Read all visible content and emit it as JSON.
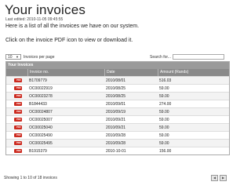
{
  "page": {
    "title": "Your invoices",
    "last_edited_label": "Last edited:",
    "last_edited_value": "2010-11-05 09:45:55",
    "intro": "Here is a list of all the invoices we have on our system.",
    "hint": "Click on the invoice PDF icon to view or download it."
  },
  "controls": {
    "per_page_value": "10",
    "per_page_label": "Invoices per page",
    "search_label": "Search for..."
  },
  "table": {
    "heading": "Your Invoices",
    "columns": [
      "",
      "Invoice no.",
      "Date",
      "Amount (Rands)"
    ],
    "pdf_label": "PDF",
    "rows": [
      {
        "invoice": "B1709779",
        "date": "2010/08/01",
        "amount": "516.03"
      },
      {
        "invoice": "OC00022919",
        "date": "2010/08/25",
        "amount": "59.00"
      },
      {
        "invoice": "OC00023278",
        "date": "2010/08/25",
        "amount": "59.00"
      },
      {
        "invoice": "B1844433",
        "date": "2010/09/01",
        "amount": "274.00"
      },
      {
        "invoice": "OC00024807",
        "date": "2010/09/19",
        "amount": "59.00"
      },
      {
        "invoice": "OC00025007",
        "date": "2010/09/21",
        "amount": "59.00"
      },
      {
        "invoice": "OC00025040",
        "date": "2010/09/21",
        "amount": "59.00"
      },
      {
        "invoice": "OC00025490",
        "date": "2010/09/28",
        "amount": "59.00"
      },
      {
        "invoice": "OC00025495",
        "date": "2010/09/28",
        "amount": "59.00"
      },
      {
        "invoice": "B1915379",
        "date": "2010-10-01",
        "amount": "156.00"
      }
    ]
  },
  "footer": {
    "summary": "Showing 1 to 10 of 18 invoices"
  },
  "pager": {
    "prev_icon": "arrow-left",
    "next_icon": "arrow-right"
  }
}
